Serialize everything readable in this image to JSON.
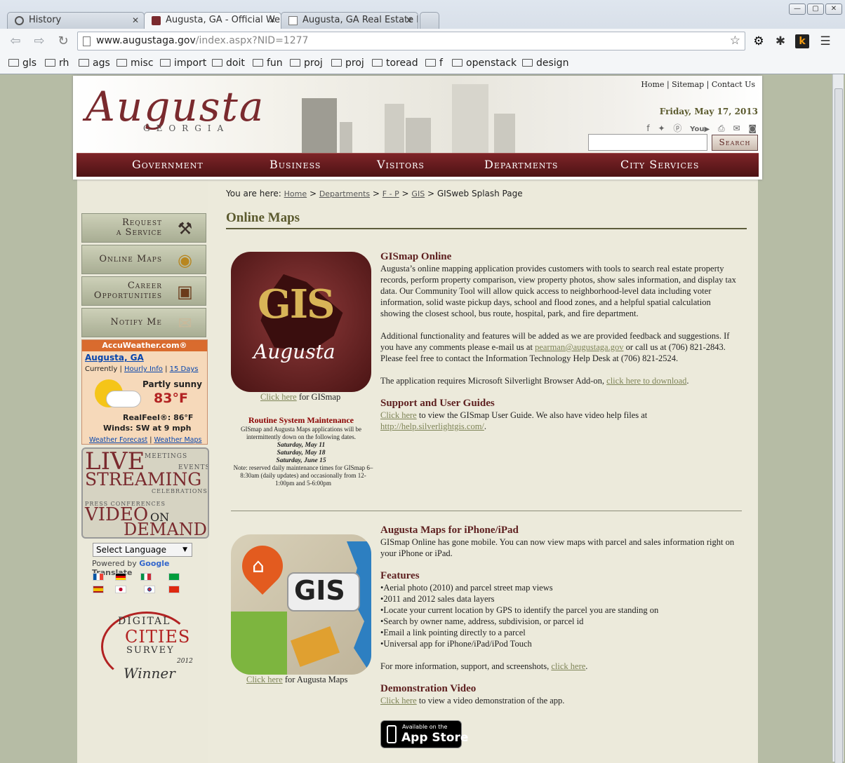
{
  "browser": {
    "tabs": [
      {
        "label": "History"
      },
      {
        "label": "Augusta, GA - Official We"
      },
      {
        "label": "Augusta, GA Real Estate F"
      }
    ],
    "url_host": "www.augustaga.gov",
    "url_path": "/index.aspx?NID=1277",
    "bookmarks": [
      "gls",
      "rh",
      "ags",
      "misc",
      "import",
      "doit",
      "fun",
      "proj",
      "proj",
      "toread",
      "f",
      "openstack",
      "design"
    ]
  },
  "header": {
    "logo_main": "Augusta",
    "logo_sub": "GEORGIA",
    "top_links": [
      "Home",
      "Sitemap",
      "Contact Us"
    ],
    "date": "Friday, May 17, 2013",
    "search_button": "Search",
    "nav": [
      "Government",
      "Business",
      "Visitors",
      "Departments",
      "City Services"
    ]
  },
  "sidebar": {
    "buttons": [
      {
        "label_line1": "Request",
        "label_line2": "a Service"
      },
      {
        "label_line1": "Online Maps",
        "label_line2": ""
      },
      {
        "label_line1": "Career",
        "label_line2": "Opportunities"
      },
      {
        "label_line1": "Notify Me",
        "label_line2": ""
      }
    ],
    "weather": {
      "brand": "AccuWeather.com®",
      "city": "Augusta, GA",
      "currently": "Currently",
      "hourly": "Hourly Info",
      "days": "15 Days",
      "condition": "Partly sunny",
      "temp": "83°F",
      "realfeel": "RealFeel®: 86°F",
      "winds": "Winds: SW at 9 mph",
      "forecast_link": "Weather Forecast",
      "maps_link": "Weather Maps"
    },
    "live": {
      "live": "LIVE",
      "streaming": "STREAMING",
      "video": "VIDEO",
      "on": "ON",
      "demand": "DEMAND",
      "meetings": "MEETINGS",
      "events": "EVENTS",
      "celebrations": "CELEBRATIONS",
      "press": "PRESS CONFERENCES"
    },
    "language_select": "Select Language",
    "powered_by": "Powered by",
    "google": "Google",
    "translate": "Translate",
    "award": {
      "line1": "DIGITAL",
      "line2": "CITIES",
      "line3": "SURVEY",
      "line4": "2012",
      "line5": "Winner"
    }
  },
  "breadcrumb": {
    "prefix": "You are here:",
    "items": [
      "Home",
      "Departments",
      "F - P",
      "GIS"
    ],
    "current": "GISweb Splash Page"
  },
  "page_title": "Online Maps",
  "gismap": {
    "icon_text": "GIS",
    "icon_script": "Augusta",
    "caption_link": "Click here",
    "caption_rest": " for GISmap",
    "maintenance_title": "Routine System Maintenance",
    "maintenance_text": "GISmap and Augusta Maps applications will be intermittently down on the following dates.",
    "dates": [
      "Saturday, May 11",
      "Saturday, May 18",
      "Saturday, June 15"
    ],
    "note": "Note: reserved daily maintenance times for GISmap 6–8:30am (daily updates) and occasionally from 12-1:00pm and 5-6:00pm",
    "title": "GISmap Online",
    "p1": "Augusta’s online mapping application provides customers with tools to search real estate property records, perform property comparison, view property photos, show sales information, and display tax data. Our Community Tool will allow quick access to neighborhood-level data including voter information, solid waste pickup days, school and flood zones, and a helpful spatial calculation showing the closest school, bus route, hospital, park, and fire department.",
    "p2a": "Additional functionality and features will be added as we are provided feedback and suggestions. If you have any comments please e-mail us at ",
    "email": "pearman@augustaga.gov",
    "p2b": " or call us at (706) 821-2843. Please feel free to contact the Information Technology Help Desk at (706) 821-2524.",
    "p3a": "The application requires Microsoft Silverlight Browser Add-on, ",
    "p3link": "click here to download",
    "p3b": ".",
    "support_title": "Support and User Guides",
    "support_link": "Click here",
    "support_text": " to view the GISmap User Guide.  We also have video help files at ",
    "support_url": "http://help.silverlightgis.com/",
    "support_end": "."
  },
  "mobile": {
    "icon_text": "GIS",
    "caption_link": "Click here",
    "caption_rest": " for Augusta Maps",
    "title": "Augusta Maps for iPhone/iPad",
    "intro": "GISmap Online has gone mobile. You can now view maps with parcel and sales information right on your iPhone or iPad.",
    "features_title": "Features",
    "features": [
      "•Aerial photo (2010) and parcel street map views",
      "•2011 and 2012 sales data layers",
      "•Locate your current location by GPS to identify the parcel you are standing on",
      "•Search by owner name, address, subdivision, or parcel id",
      "•Email a link pointing directly to a parcel",
      "•Universal app for iPhone/iPad/iPod Touch"
    ],
    "more_a": "For more information, support, and screenshots, ",
    "more_link": "click here",
    "more_b": ".",
    "demo_title": "Demonstration Video",
    "demo_link": "Click here",
    "demo_text": " to view a video demonstration of the app.",
    "appstore_small": "Available on the",
    "appstore_big": "App Store"
  }
}
